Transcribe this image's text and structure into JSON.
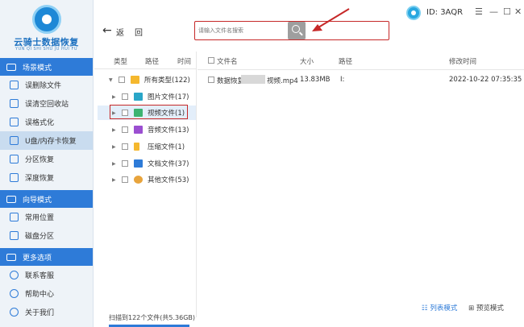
{
  "app": {
    "logo_title": "云骑士数据恢复",
    "logo_sub": "YUN QI SHI SHU JU HUI FU"
  },
  "sidebar": {
    "sections": [
      {
        "title": "场景模式",
        "items": [
          {
            "label": "误删除文件"
          },
          {
            "label": "误清空回收站"
          },
          {
            "label": "误格式化"
          },
          {
            "label": "U盘/内存卡恢复"
          },
          {
            "label": "分区恢复"
          },
          {
            "label": "深度恢复"
          }
        ]
      },
      {
        "title": "向导模式",
        "items": [
          {
            "label": "常用位置"
          },
          {
            "label": "磁盘分区"
          }
        ]
      },
      {
        "title": "更多选项",
        "items": [
          {
            "label": "联系客服"
          },
          {
            "label": "帮助中心"
          },
          {
            "label": "关于我们"
          }
        ]
      }
    ]
  },
  "topbar": {
    "back_label": "返",
    "home_label": "回",
    "search_placeholder": "请输入文件名搜索",
    "user_id": "ID: 3AQR",
    "window_controls": [
      "☰",
      "—",
      "☐",
      "✕"
    ]
  },
  "left_pane": {
    "headers": [
      "类型",
      "路径",
      "时间"
    ],
    "tree": [
      {
        "label": "所有类型(122)",
        "icon_color": "#f5b82e"
      },
      {
        "label": "图片文件(17)",
        "icon_color": "#2aa6c8"
      },
      {
        "label": "视频文件(1)",
        "icon_color": "#3cb371"
      },
      {
        "label": "音频文件(13)",
        "icon_color": "#9b4fd1"
      },
      {
        "label": "压缩文件(1)",
        "icon_color": "#f5b82e"
      },
      {
        "label": "文档文件(37)",
        "icon_color": "#2e7bd8"
      },
      {
        "label": "其他文件(53)",
        "icon_color": "#e8a43c"
      }
    ]
  },
  "right_pane": {
    "headers": {
      "name": "文件名",
      "size": "大小",
      "path": "路径",
      "mtime": "修改时间"
    },
    "files": [
      {
        "name_prefix": "数据恢复",
        "name_suffix": "视频.mp4",
        "size": "13.83MB",
        "path": "I:",
        "mtime": "2022-10-22 07:35:35"
      }
    ]
  },
  "bottom": {
    "scan_text": "扫描到122个文件(共5.36GB)",
    "list_view": "列表模式",
    "preview_view": "预览模式"
  },
  "colors": {
    "accent": "#2e7bd8",
    "annotation_red": "#c62828"
  }
}
